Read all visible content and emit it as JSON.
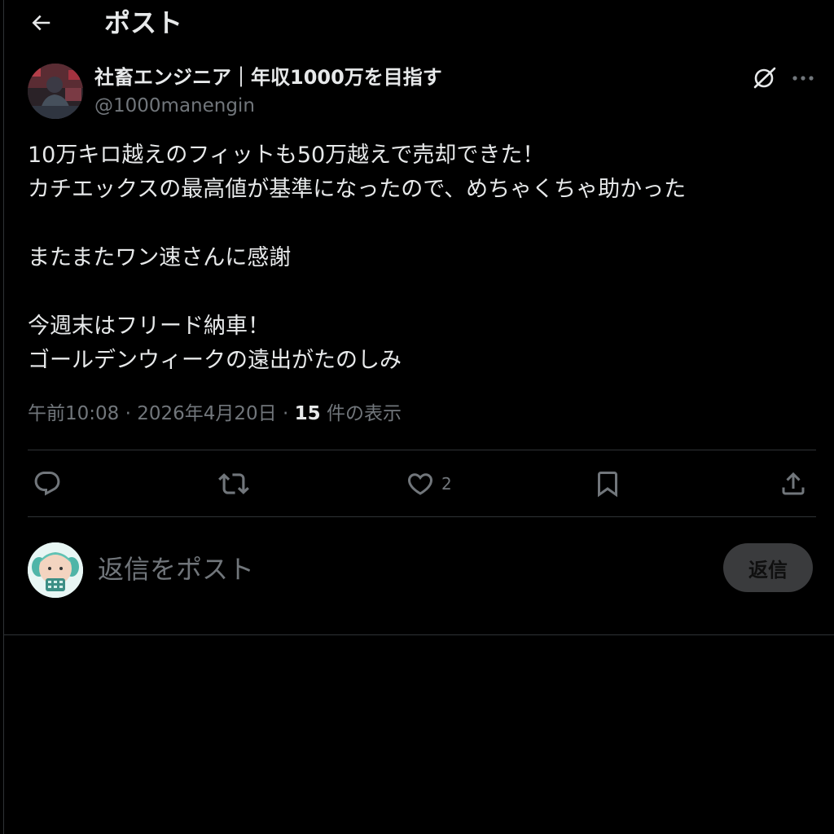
{
  "header": {
    "title": "ポスト",
    "back_icon": "arrow-left-icon"
  },
  "author": {
    "name": "社畜エンジニア｜年収1000万を目指す",
    "handle": "@1000manengin"
  },
  "post": {
    "lines": [
      "10万キロ越えのフィットも50万越えで売却できた！",
      "カチエックスの最高値が基準になったので、めちゃくちゃ助かった",
      "",
      "またまたワン速さんに感謝",
      "",
      "今週末はフリード納車！",
      "ゴールデンウィークの遠出がたのしみ"
    ]
  },
  "meta": {
    "time": "午前10:08",
    "separator": "·",
    "date": "2026年4月20日",
    "views_count": "15",
    "views_label": "件の表示"
  },
  "actions": {
    "reply_icon": "comment-icon",
    "repost_icon": "repost-icon",
    "like_icon": "heart-icon",
    "like_count": "2",
    "bookmark_icon": "bookmark-icon",
    "share_icon": "share-icon"
  },
  "composer": {
    "placeholder": "返信をポスト",
    "button_label": "返信"
  },
  "colors": {
    "background": "#000000",
    "text": "#e7e9ea",
    "muted": "#71767b",
    "border": "#2f3336",
    "reply_button_bg": "#3a3b3d"
  }
}
